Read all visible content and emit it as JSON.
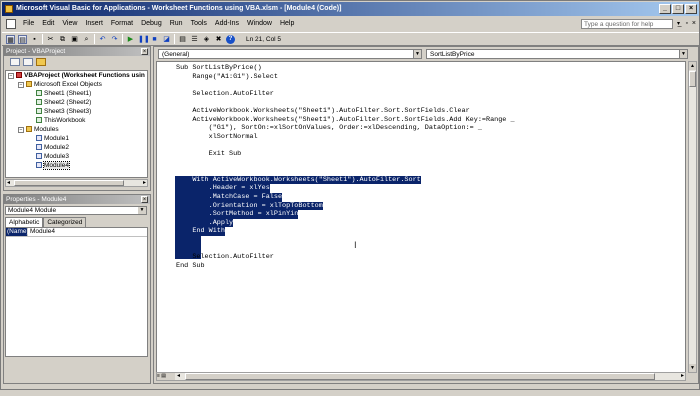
{
  "window": {
    "title": "Microsoft Visual Basic for Applications - Worksheet Functions using VBA.xlsm - [Module4 (Code)]",
    "controls": [
      "_",
      "□",
      "×"
    ]
  },
  "menu": {
    "items": [
      "File",
      "Edit",
      "View",
      "Insert",
      "Format",
      "Debug",
      "Run",
      "Tools",
      "Add-Ins",
      "Window",
      "Help"
    ],
    "help_placeholder": "Type a question for help",
    "mdi_controls": "_ ▫ ×"
  },
  "toolbar": {
    "position": "Ln 21, Col 5"
  },
  "project": {
    "title": "Project - VBAProject",
    "root": "VBAProject (Worksheet Functions usin",
    "excel_objects": "Microsoft Excel Objects",
    "sheets": [
      "Sheet1 (Sheet1)",
      "Sheet2 (Sheet2)",
      "Sheet3 (Sheet3)",
      "ThisWorkbook"
    ],
    "modules_folder": "Modules",
    "modules": [
      "Module1",
      "Module2",
      "Module3",
      "Module4"
    ]
  },
  "properties": {
    "title": "Properties - Module4",
    "object": "Module4  Module",
    "tabs": [
      "Alphabetic",
      "Categorized"
    ],
    "rows": [
      {
        "key": "(Name)",
        "value": "Module4"
      }
    ]
  },
  "code": {
    "object_combo": "(General)",
    "proc_combo": "SortListByPrice",
    "lines": [
      "Sub SortListByPrice()",
      "    Range(\"A1:G1\").Select",
      "",
      "    Selection.AutoFilter",
      "",
      "    ActiveWorkbook.Worksheets(\"Sheet1\").AutoFilter.Sort.SortFields.Clear",
      "    ActiveWorkbook.Worksheets(\"Sheet1\").AutoFilter.Sort.SortFields.Add Key:=Range _",
      "        (\"G1\"), SortOn:=xlSortOnValues, Order:=xlDescending, DataOption:= _",
      "        xlSortNormal",
      "",
      "        Exit Sub",
      "",
      "",
      "    With ActiveWorkbook.Worksheets(\"Sheet1\").AutoFilter.Sort",
      "        .Header = xlYes",
      "        .MatchCase = False",
      "        .Orientation = xlTopToBottom",
      "        .SortMethod = xlPinYin",
      "        .Apply",
      "    End With",
      "",
      "",
      "    Selection.AutoFilter",
      "End Sub"
    ]
  }
}
